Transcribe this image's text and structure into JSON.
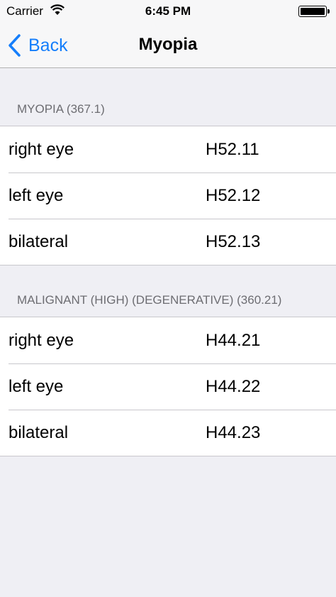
{
  "status_bar": {
    "carrier": "Carrier",
    "time": "6:45 PM",
    "wifi_icon": "wifi-icon",
    "battery_icon": "battery-icon"
  },
  "nav": {
    "back_label": "Back",
    "back_icon": "chevron-left-icon",
    "title": "Myopia",
    "accent_color": "#157efb"
  },
  "sections": [
    {
      "header": "MYOPIA (367.1)",
      "rows": [
        {
          "label": "right eye",
          "code": "H52.11"
        },
        {
          "label": "left eye",
          "code": "H52.12"
        },
        {
          "label": "bilateral",
          "code": "H52.13"
        }
      ]
    },
    {
      "header": "MALIGNANT (HIGH) (DEGENERATIVE) (360.21)",
      "rows": [
        {
          "label": "right eye",
          "code": "H44.21"
        },
        {
          "label": "left eye",
          "code": "H44.22"
        },
        {
          "label": "bilateral",
          "code": "H44.23"
        }
      ]
    }
  ]
}
